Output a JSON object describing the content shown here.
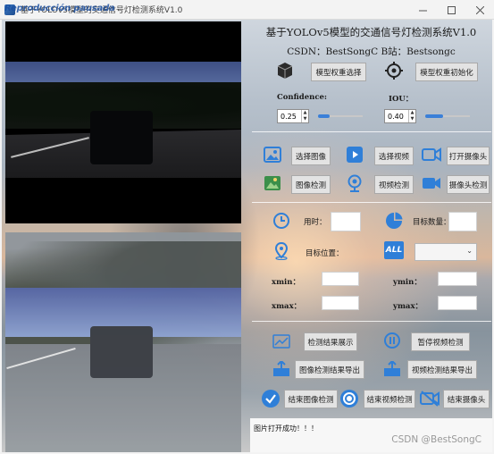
{
  "window": {
    "title": "基于YOLOv5模型的交通信号灯检测系统V1.0",
    "overlay_tag": "Reproducción pausada",
    "controls": [
      "minimize",
      "maximize",
      "close"
    ]
  },
  "header": {
    "heading": "基于YOLOv5模型的交通信号灯检测系统V1.0",
    "subheading": "CSDN：BestSongC   B站：Bestsongc"
  },
  "model": {
    "select_label": "模型权重选择",
    "init_label": "模型权重初始化",
    "select_icon": "cube-icon",
    "init_icon": "target-icon"
  },
  "thresholds": {
    "confidence_label": "Confidence:",
    "confidence_value": "0.25",
    "confidence_fraction": 0.25,
    "iou_label": "IOU：",
    "iou_value": "0.40",
    "iou_fraction": 0.4
  },
  "sources": {
    "select_image": "选择图像",
    "select_video": "选择视频",
    "open_camera": "打开摄像头",
    "image_detect": "图像检测",
    "video_detect": "视频检测",
    "camera_detect": "摄像头检测"
  },
  "stats": {
    "time_label": "用时：",
    "time_value": "",
    "count_label": "目标数量：",
    "count_value": "",
    "position_label": "目标位置：",
    "position_select_value": "",
    "xmin_label": "xmin：",
    "ymin_label": "ymin：",
    "xmax_label": "xmax：",
    "ymax_label": "ymax：",
    "all_badge": "ALL"
  },
  "actions": {
    "show_results": "检测结果展示",
    "pause_video": "暂停视频检测",
    "export_image": "图像检测结果导出",
    "export_video": "视频检测结果导出",
    "end_image": "结束图像检测",
    "end_video": "结束视频检测",
    "end_camera": "结束摄像头"
  },
  "status": {
    "message": "图片打开成功！！！"
  },
  "watermark": "CSDN @BestSongC",
  "colors": {
    "accent_blue": "#2f7fd8",
    "button_bg": "#e3e3e3"
  }
}
